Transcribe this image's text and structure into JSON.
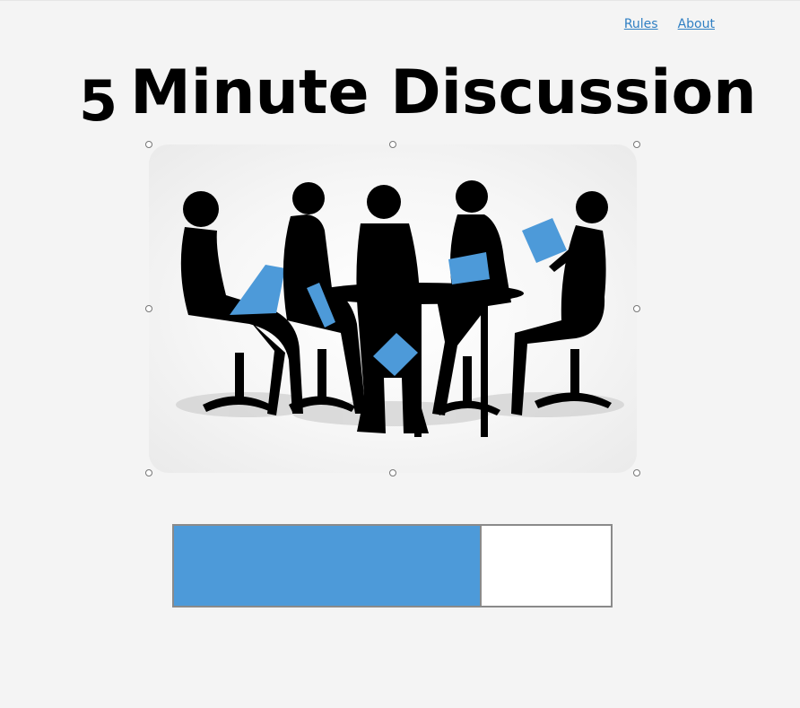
{
  "nav": {
    "links": [
      "Rules",
      "About"
    ]
  },
  "title": {
    "number": "5",
    "text": "Minute Discussion"
  },
  "image": {
    "subject": "silhouettes of five people in a meeting around a table",
    "accent_color": "#4d9ad9"
  },
  "progress": {
    "fraction": 0.705,
    "fill_color": "#4d9ad9"
  },
  "colors": {
    "background": "#f4f4f4",
    "link": "#2f7fc3",
    "title": "#000000"
  }
}
